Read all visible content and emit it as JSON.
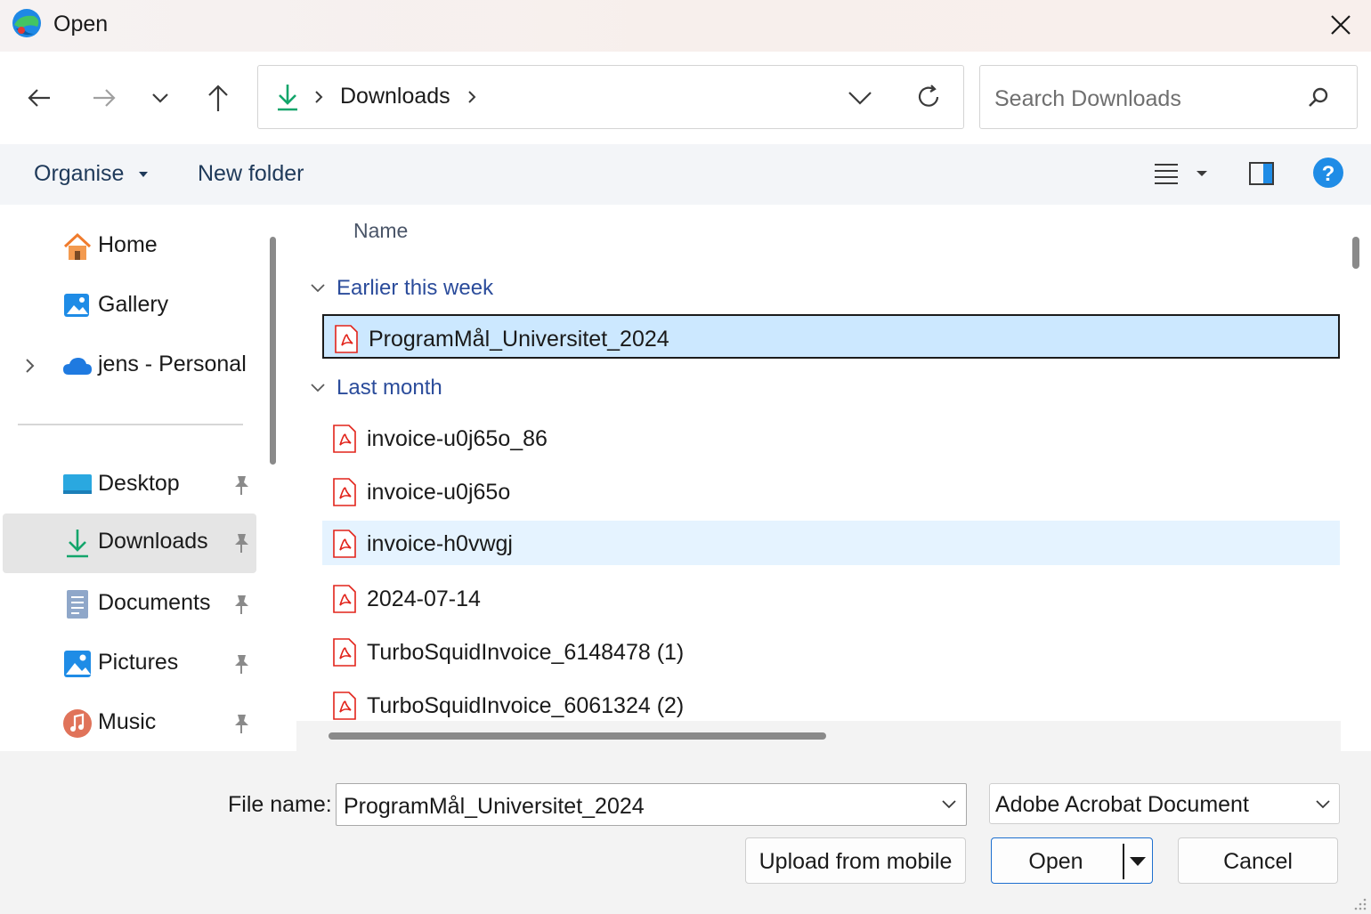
{
  "window": {
    "title": "Open",
    "app_icon": "edge-icon",
    "close_icon": "close-icon"
  },
  "nav": {
    "back_icon": "arrow-left-icon",
    "forward_icon": "arrow-right-icon",
    "recent_icon": "chevron-down-icon",
    "up_icon": "arrow-up-icon",
    "breadcrumb": [
      "Downloads"
    ],
    "refresh_icon": "refresh-icon",
    "search_placeholder": "Search Downloads"
  },
  "toolbar": {
    "organise": "Organise",
    "new_folder": "New folder"
  },
  "sidebar": {
    "items": [
      {
        "label": "Home",
        "icon": "home-icon"
      },
      {
        "label": "Gallery",
        "icon": "gallery-icon"
      },
      {
        "label": "jens - Personal",
        "icon": "onedrive-icon"
      },
      {
        "label": "Desktop",
        "icon": "desktop-icon",
        "pinned": true
      },
      {
        "label": "Downloads",
        "icon": "download-icon",
        "pinned": true,
        "selected": true
      },
      {
        "label": "Documents",
        "icon": "documents-icon",
        "pinned": true
      },
      {
        "label": "Pictures",
        "icon": "pictures-icon",
        "pinned": true
      },
      {
        "label": "Music",
        "icon": "music-icon",
        "pinned": true
      }
    ]
  },
  "files": {
    "column_name": "Name",
    "groups": [
      {
        "label": "Earlier this week",
        "items": [
          "ProgramMål_Universitet_2024"
        ]
      },
      {
        "label": "Last month",
        "items": [
          "invoice-u0j65o_86",
          "invoice-u0j65o",
          "invoice-h0vwgj",
          "2024-07-14",
          "TurboSquidInvoice_6148478 (1)",
          "TurboSquidInvoice_6061324 (2)"
        ]
      }
    ]
  },
  "bottom": {
    "file_name_label": "File name:",
    "file_name_value": "ProgramMål_Universitet_2024",
    "file_type": "Adobe Acrobat Document",
    "upload_button": "Upload from mobile",
    "open_button": "Open",
    "cancel_button": "Cancel"
  },
  "colors": {
    "accent": "#1d6fcf",
    "selection": "#cce8ff",
    "hover": "#e5f3ff",
    "group_head": "#2b4c9b",
    "pdf_red": "#e2231a"
  }
}
